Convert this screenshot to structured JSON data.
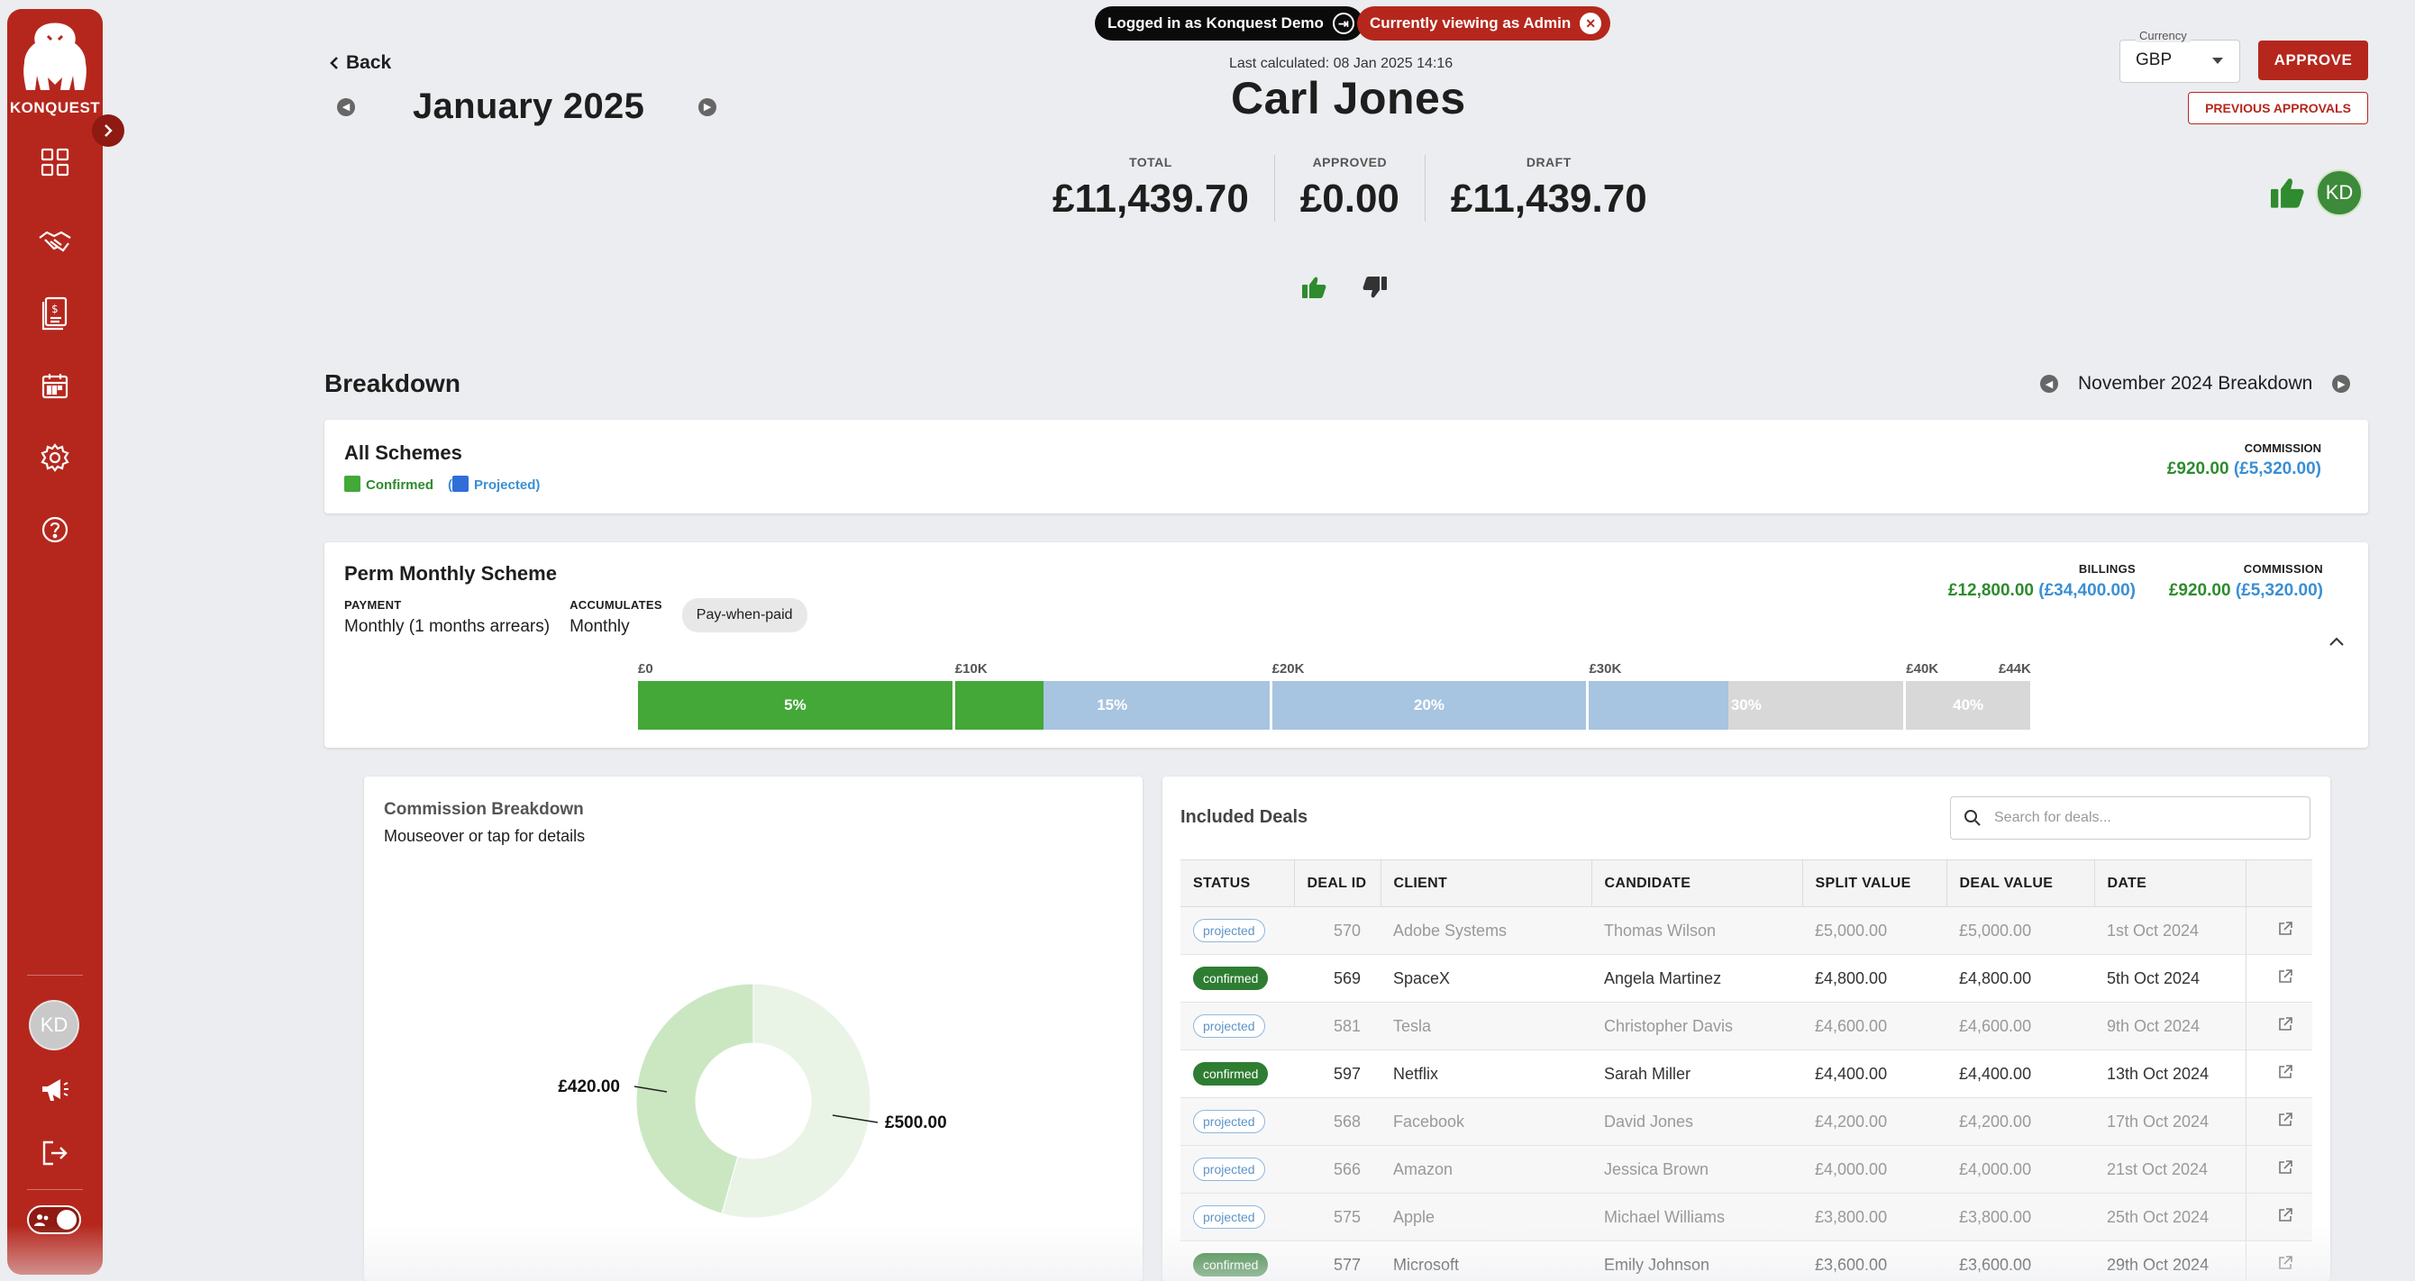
{
  "brand": {
    "name": "KONQUEST",
    "color": "#b5271d"
  },
  "sidebar": {
    "nav": [
      {
        "name": "dashboard-icon"
      },
      {
        "name": "deals-handshake-icon"
      },
      {
        "name": "commission-statement-icon"
      },
      {
        "name": "calendar-icon"
      },
      {
        "name": "settings-gear-icon"
      },
      {
        "name": "help-icon"
      }
    ],
    "user_initials": "KD"
  },
  "banners": {
    "logged_in": "Logged in as Konquest Demo",
    "viewing": "Currently viewing as Admin"
  },
  "header": {
    "back_label": "Back",
    "month": "January 2025",
    "last_calculated": "Last calculated: 08 Jan 2025 14:16",
    "name": "Carl Jones"
  },
  "totals": {
    "total_label": "TOTAL",
    "total_value": "£11,439.70",
    "approved_label": "APPROVED",
    "approved_value": "£0.00",
    "draft_label": "DRAFT",
    "draft_value": "£11,439.70"
  },
  "currency": {
    "label": "Currency",
    "value": "GBP"
  },
  "actions": {
    "approve": "APPROVE",
    "previous_approvals": "PREVIOUS APPROVALS",
    "approver_initials": "KD"
  },
  "breakdown": {
    "title": "Breakdown",
    "nav_label": "November 2024 Breakdown"
  },
  "all_schemes": {
    "title": "All Schemes",
    "legend_confirmed": "Confirmed",
    "legend_projected": "Projected",
    "commission_label": "COMMISSION",
    "commission_confirmed": "£920.00",
    "commission_projected": "(£5,320.00)"
  },
  "scheme": {
    "title": "Perm Monthly Scheme",
    "payment_label": "PAYMENT",
    "payment_value": "Monthly (1 months arrears)",
    "accumulates_label": "ACCUMULATES",
    "accumulates_value": "Monthly",
    "badge": "Pay-when-paid",
    "billings_label": "BILLINGS",
    "billings_confirmed": "£12,800.00",
    "billings_projected": "(£34,400.00)",
    "commission_label": "COMMISSION",
    "commission_confirmed": "£920.00",
    "commission_projected": "(£5,320.00)",
    "ticks": [
      "£0",
      "£10K",
      "£20K",
      "£30K",
      "£40K",
      "£44K"
    ],
    "tiers": [
      {
        "rate": "5%",
        "from": 0,
        "to": 10000,
        "confirmed_fill": 1.0,
        "projected_fill": 0
      },
      {
        "rate": "15%",
        "from": 10000,
        "to": 20000,
        "confirmed_fill": 0.28,
        "projected_fill": 0.72
      },
      {
        "rate": "20%",
        "from": 20000,
        "to": 30000,
        "confirmed_fill": 0,
        "projected_fill": 1.0
      },
      {
        "rate": "30%",
        "from": 30000,
        "to": 40000,
        "confirmed_fill": 0,
        "projected_fill": 0.44
      },
      {
        "rate": "40%",
        "from": 40000,
        "to": 44000,
        "confirmed_fill": 0,
        "projected_fill": 0
      }
    ],
    "colors": {
      "confirmed": "#43a838",
      "projected": "#a7c4e0",
      "empty": "#d8d8d8"
    }
  },
  "commission_breakdown": {
    "title": "Commission Breakdown",
    "subtitle": "Mouseover or tap for details",
    "chart_data": {
      "type": "pie",
      "values": [
        500,
        420
      ],
      "labels": [
        "£500.00",
        "£420.00"
      ],
      "colors": [
        "#eaf4e6",
        "#cbe7c2"
      ]
    }
  },
  "deals": {
    "title": "Included Deals",
    "search_placeholder": "Search for deals...",
    "columns": [
      "STATUS",
      "DEAL ID",
      "CLIENT",
      "CANDIDATE",
      "SPLIT VALUE",
      "DEAL VALUE",
      "DATE"
    ],
    "rows": [
      {
        "status": "projected",
        "id": "570",
        "client": "Adobe Systems",
        "candidate": "Thomas Wilson",
        "split": "£5,000.00",
        "value": "£5,000.00",
        "date": "1st Oct 2024"
      },
      {
        "status": "confirmed",
        "id": "569",
        "client": "SpaceX",
        "candidate": "Angela Martinez",
        "split": "£4,800.00",
        "value": "£4,800.00",
        "date": "5th Oct 2024"
      },
      {
        "status": "projected",
        "id": "581",
        "client": "Tesla",
        "candidate": "Christopher Davis",
        "split": "£4,600.00",
        "value": "£4,600.00",
        "date": "9th Oct 2024"
      },
      {
        "status": "confirmed",
        "id": "597",
        "client": "Netflix",
        "candidate": "Sarah Miller",
        "split": "£4,400.00",
        "value": "£4,400.00",
        "date": "13th Oct 2024"
      },
      {
        "status": "projected",
        "id": "568",
        "client": "Facebook",
        "candidate": "David Jones",
        "split": "£4,200.00",
        "value": "£4,200.00",
        "date": "17th Oct 2024"
      },
      {
        "status": "projected",
        "id": "566",
        "client": "Amazon",
        "candidate": "Jessica Brown",
        "split": "£4,000.00",
        "value": "£4,000.00",
        "date": "21st Oct 2024"
      },
      {
        "status": "projected",
        "id": "575",
        "client": "Apple",
        "candidate": "Michael Williams",
        "split": "£3,800.00",
        "value": "£3,800.00",
        "date": "25th Oct 2024"
      },
      {
        "status": "confirmed",
        "id": "577",
        "client": "Microsoft",
        "candidate": "Emily Johnson",
        "split": "£3,600.00",
        "value": "£3,600.00",
        "date": "29th Oct 2024"
      }
    ]
  }
}
